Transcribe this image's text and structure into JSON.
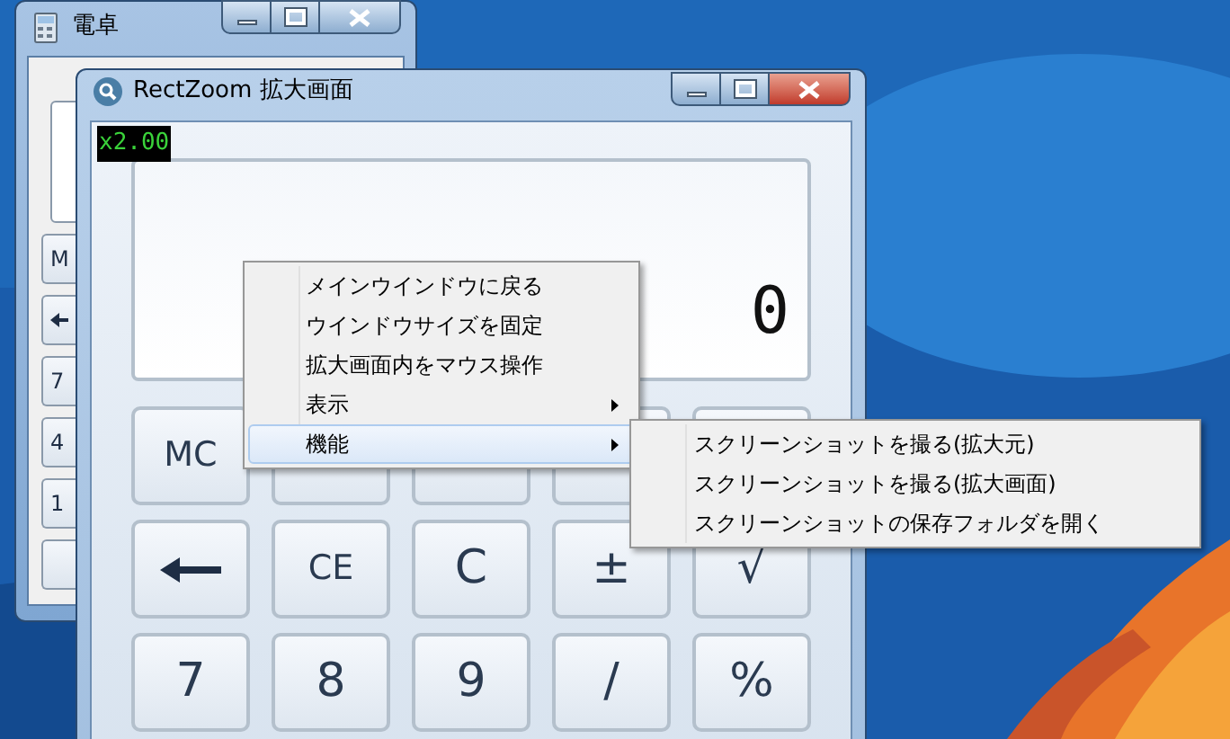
{
  "back_window": {
    "title": "電卓",
    "keys": [
      {
        "kind": "text",
        "label": "M"
      },
      {
        "kind": "arrow"
      },
      {
        "kind": "text",
        "label": "7"
      },
      {
        "kind": "text",
        "label": "4"
      },
      {
        "kind": "text",
        "label": "1"
      },
      {
        "kind": "blank"
      }
    ]
  },
  "zoom_window": {
    "title": "RectZoom 拡大画面",
    "zoom_badge": "x2.00",
    "display": "0",
    "keys": [
      {
        "kind": "text",
        "label": "MC"
      },
      {
        "kind": "blank"
      },
      {
        "kind": "blank"
      },
      {
        "kind": "blank"
      },
      {
        "kind": "blank"
      },
      {
        "kind": "arrow"
      },
      {
        "kind": "text",
        "label": "CE"
      },
      {
        "kind": "text",
        "label": "C"
      },
      {
        "kind": "text",
        "label": "±"
      },
      {
        "kind": "text",
        "label": "√"
      },
      {
        "kind": "text",
        "label": "7"
      },
      {
        "kind": "text",
        "label": "8"
      },
      {
        "kind": "text",
        "label": "9"
      },
      {
        "kind": "text",
        "label": "/"
      },
      {
        "kind": "text",
        "label": "%"
      }
    ]
  },
  "context_menu": {
    "items": [
      {
        "label": "メインウインドウに戻る",
        "submenu": false,
        "selected": false
      },
      {
        "label": "ウインドウサイズを固定",
        "submenu": false,
        "selected": false
      },
      {
        "label": "拡大画面内をマウス操作",
        "submenu": false,
        "selected": false
      },
      {
        "label": "表示",
        "submenu": true,
        "selected": false
      },
      {
        "label": "機能",
        "submenu": true,
        "selected": true
      }
    ]
  },
  "submenu": {
    "items": [
      {
        "label": "スクリーンショットを撮る(拡大元)",
        "selected": false
      },
      {
        "label": "スクリーンショットを撮る(拡大画面)",
        "selected": false
      },
      {
        "label": "スクリーンショットの保存フォルダを開く",
        "selected": false
      }
    ]
  }
}
